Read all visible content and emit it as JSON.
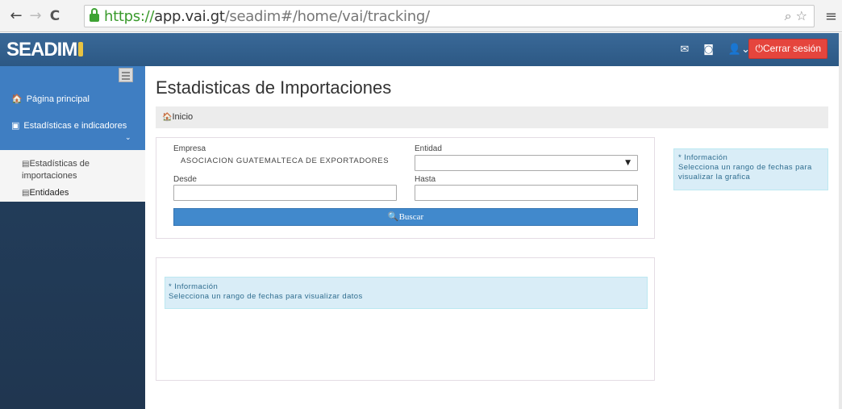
{
  "browser": {
    "url_scheme": "https://",
    "url_host": "app.vai.gt",
    "url_path": "/seadim#/home/vai/tracking/"
  },
  "header": {
    "brand": "SEADIM",
    "logout_label": "Cerrar sesión"
  },
  "sidebar": {
    "items": [
      {
        "label": "Página principal",
        "icon": "home-icon"
      },
      {
        "label": "Estadísticas e indicadores",
        "icon": "file-icon"
      }
    ],
    "subitems": [
      {
        "label": "Estadísticas de importaciones",
        "icon": "list-icon"
      },
      {
        "label": "Entidades",
        "icon": "list-icon"
      }
    ]
  },
  "main": {
    "title": "Estadisticas de Importaciones",
    "breadcrumb": "Inicio"
  },
  "form": {
    "empresa_label": "Empresa",
    "empresa_value": "ASOCIACION GUATEMALTECA DE EXPORTADORES",
    "entidad_label": "Entidad",
    "entidad_value": "",
    "desde_label": "Desde",
    "desde_value": "",
    "hasta_label": "Hasta",
    "hasta_value": "",
    "buscar_label": "Buscar"
  },
  "info_chart": {
    "title": "* Información",
    "text": "Selecciona un rango de fechas para visualizar la grafica"
  },
  "info_data": {
    "title": "* Información",
    "text": "Selecciona un rango de fechas para visualizar datos"
  },
  "colors": {
    "topbar": "#2f5d8a",
    "sidebar_active": "#3f7ec2",
    "logout": "#e5453d",
    "buscar": "#4189cc",
    "info_bg": "#d9edf7"
  }
}
